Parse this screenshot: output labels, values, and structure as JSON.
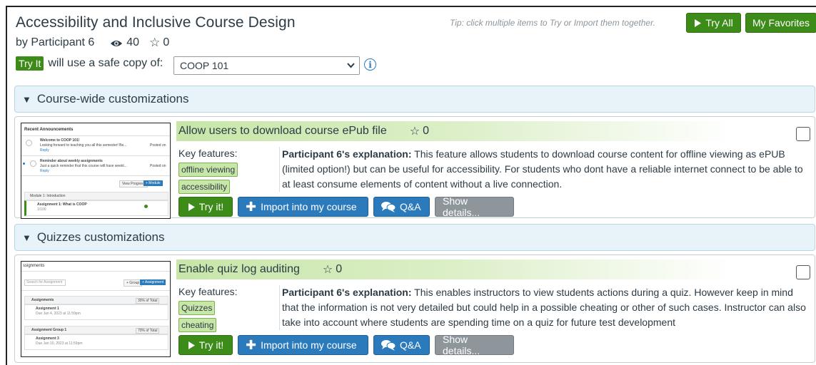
{
  "header": {
    "title": "Accessibility and Inclusive Course Design",
    "byline": "by Participant 6",
    "views": "40",
    "favorites": "0",
    "tip": "Tip: click multiple items to Try or Import them together.",
    "try_all_label": "Try All",
    "my_favorites_label": "My Favorites"
  },
  "tryit": {
    "badge": "Try It",
    "text": "will use a safe copy of:",
    "selected_course": "COOP 101"
  },
  "sections": [
    {
      "title": "Course-wide customizations",
      "card": {
        "title": "Allow users to download course ePub file",
        "stars": "0",
        "key_features_label": "Key features:",
        "tags": [
          "offline viewing",
          "accessibility"
        ],
        "explanation_author": "Participant 6's explanation:",
        "explanation": "This feature allows students to download course content for offline viewing as ePUB (limited option!) but can be useful for accessibility. For students who dont have a reliable internet connect to be able to at least consume elements of content without a live connection.",
        "thumb": {
          "heading": "Recent Announcements",
          "item1_title": "Welcome to COOP 101!",
          "item1_body": "Looking forward to teaching you all this semester! Be...",
          "item1_reply": "Reply",
          "item1_meta": "Posted on",
          "item2_title": "Reminder about weekly assignments",
          "item2_body": "Just a quick reminder that this course will have weekl...",
          "item2_reply": "Reply",
          "item2_meta": "Posted on",
          "view_progress": "View Progress",
          "add_module": "+ Module",
          "module_name": "Module 1: Introduction",
          "assignment_name": "Assignment 1: What is COOP",
          "assignment_meta": "1/100"
        }
      }
    },
    {
      "title": "Quizzes customizations",
      "card": {
        "title": "Enable quiz log auditing",
        "stars": "0",
        "key_features_label": "Key features:",
        "tags": [
          "Quizzes",
          "cheating"
        ],
        "explanation_author": "Participant 6's explanation:",
        "explanation": "This enables instructors to view students actions during a quiz. However keep in mind that the information is not very detailed but could help in a possible cheating or other of such cases. Instructor can also take into account where students are spending time on a quiz for future test development",
        "thumb": {
          "heading": "ssignments",
          "search_placeholder": "Search for Assignment",
          "group_btn": "+ Group",
          "assignment_btn": "+ Assignment",
          "group1": "Assignments",
          "group1_meta": "30% of Total",
          "a1": "Assignment 1",
          "a1_meta": "Due Jan 4, 2023 at 11:59pm",
          "group2": "Assignment Group 1",
          "group2_meta": "70% of Total",
          "a2": "Assignment 3",
          "a2_meta": "Due Jan 10, 2023 at 11:59pm"
        }
      }
    }
  ],
  "actions": {
    "try_label": "Try it!",
    "import_label": "Import into my course",
    "qa_label": "Q&A",
    "details_label": "Show details..."
  },
  "colors": {
    "green": "#3d8c1a",
    "blue": "#2b7abc",
    "gray": "#8e959b",
    "section_bg": "#e8f3f9",
    "tag_bg": "#c7e6a8"
  }
}
